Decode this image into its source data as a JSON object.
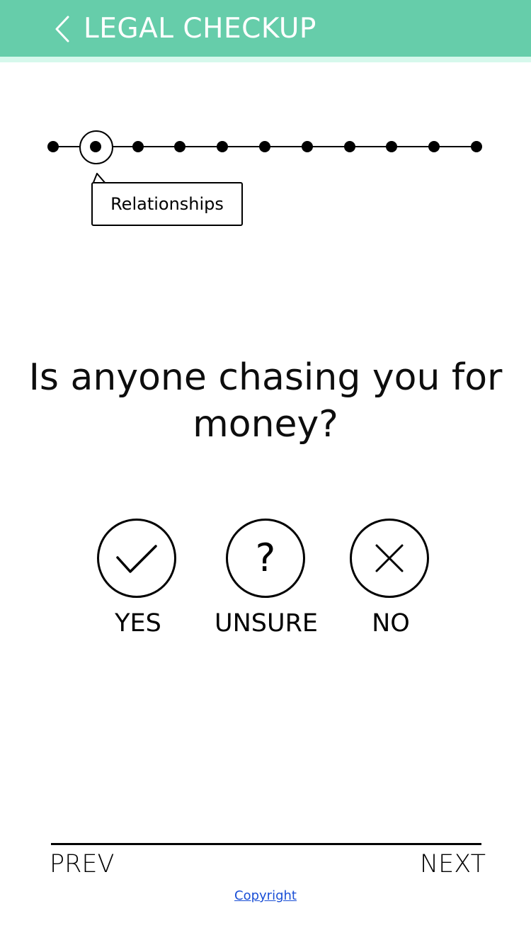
{
  "header": {
    "title": "LEGAL CHECKUP",
    "back_icon": "chevron-left-icon",
    "background_color": "#66cdaa"
  },
  "progress": {
    "total_steps": 11,
    "current_step": 2,
    "current_section": "Relationships"
  },
  "question": {
    "text": "Is anyone chasing you for money?"
  },
  "answers": [
    {
      "label": "YES",
      "icon": "check-icon"
    },
    {
      "label": "UNSURE",
      "icon": "question-icon"
    },
    {
      "label": "NO",
      "icon": "close-icon"
    }
  ],
  "nav": {
    "prev_label": "PREV",
    "next_label": "NEXT"
  },
  "footer": {
    "copyright_label": "Copyright",
    "link_color": "#1a4fd6"
  }
}
